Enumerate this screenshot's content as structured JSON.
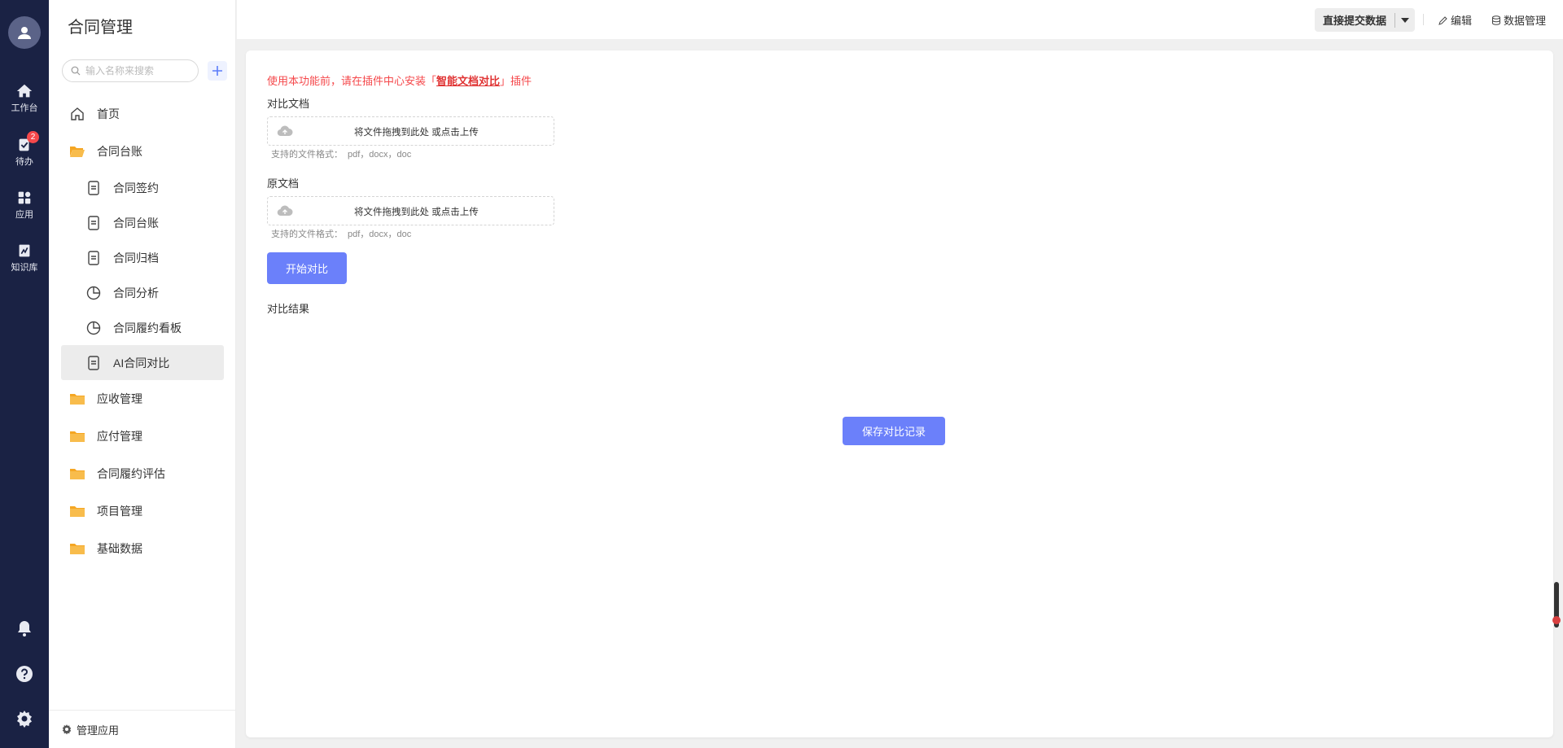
{
  "rail": {
    "items": [
      {
        "label": "工作台",
        "icon": "home-icon"
      },
      {
        "label": "待办",
        "icon": "todo-icon",
        "badge": "2"
      },
      {
        "label": "应用",
        "icon": "apps-icon"
      },
      {
        "label": "知识库",
        "icon": "knowledge-icon"
      }
    ],
    "bottom_icons": [
      "bell-icon",
      "help-icon",
      "settings-icon"
    ]
  },
  "sidebar": {
    "title": "合同管理",
    "search_placeholder": "输入名称来搜索",
    "items": [
      {
        "label": "首页",
        "level": "top",
        "icon": "home-outline-icon"
      },
      {
        "label": "合同台账",
        "level": "top",
        "icon": "folder-open-icon"
      },
      {
        "label": "合同签约",
        "level": "sub",
        "icon": "document-icon"
      },
      {
        "label": "合同台账",
        "level": "sub",
        "icon": "document-icon"
      },
      {
        "label": "合同归档",
        "level": "sub",
        "icon": "document-icon"
      },
      {
        "label": "合同分析",
        "level": "sub",
        "icon": "pie-chart-icon"
      },
      {
        "label": "合同履约看板",
        "level": "sub",
        "icon": "pie-chart-icon"
      },
      {
        "label": "AI合同对比",
        "level": "sub",
        "icon": "document-icon",
        "active": true
      },
      {
        "label": "应收管理",
        "level": "top",
        "icon": "folder-icon"
      },
      {
        "label": "应付管理",
        "level": "top",
        "icon": "folder-icon"
      },
      {
        "label": "合同履约评估",
        "level": "top",
        "icon": "folder-icon"
      },
      {
        "label": "项目管理",
        "level": "top",
        "icon": "folder-icon"
      },
      {
        "label": "基础数据",
        "level": "top",
        "icon": "folder-icon"
      }
    ],
    "footer_label": "管理应用"
  },
  "topbar": {
    "submit_label": "直接提交数据",
    "edit_label": "编辑",
    "data_manage_label": "数据管理"
  },
  "main": {
    "notice_prefix": "使用本功能前，请在插件中心安装「",
    "notice_link": "智能文档对比",
    "notice_suffix": "」插件",
    "compare_doc_label": "对比文档",
    "original_doc_label": "原文档",
    "upload_text": "将文件拖拽到此处 或点击上传",
    "formats_label": "支持的文件格式：",
    "formats_value": "pdf，docx，doc",
    "start_button": "开始对比",
    "result_label": "对比结果",
    "save_button": "保存对比记录"
  },
  "colors": {
    "rail_bg": "#1a2244",
    "primary": "#6b80fa",
    "warning_text": "#f5484b",
    "folder": "#f5a623"
  }
}
